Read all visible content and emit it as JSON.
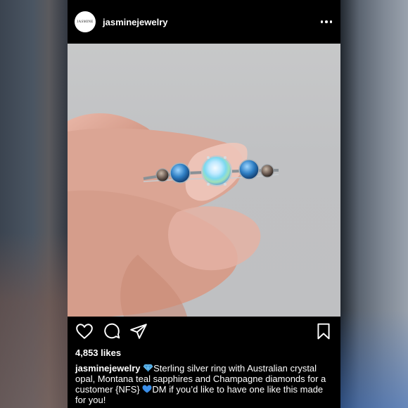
{
  "post": {
    "username": "jasminejewelry",
    "avatar_text": "JASMINE",
    "likes": "4,853 likes",
    "caption": {
      "author": "jasminejewelry",
      "part1": "Sterling silver ring with Australian crystal opal, Montana teal sapphires and Champagne diamonds for a customer {NFS}",
      "part2": "DM if you’d like to have one like this made for you!",
      "emoji1": "gem-stone-icon",
      "emoji2": "blue-heart-icon"
    },
    "icons": [
      "heart-icon",
      "comment-icon",
      "share-icon",
      "bookmark-icon",
      "more-icon"
    ],
    "colors": {
      "background": "#000000",
      "text": "#ffffff",
      "gem": "#5fb0e8",
      "heart": "#3a8ee8"
    }
  }
}
